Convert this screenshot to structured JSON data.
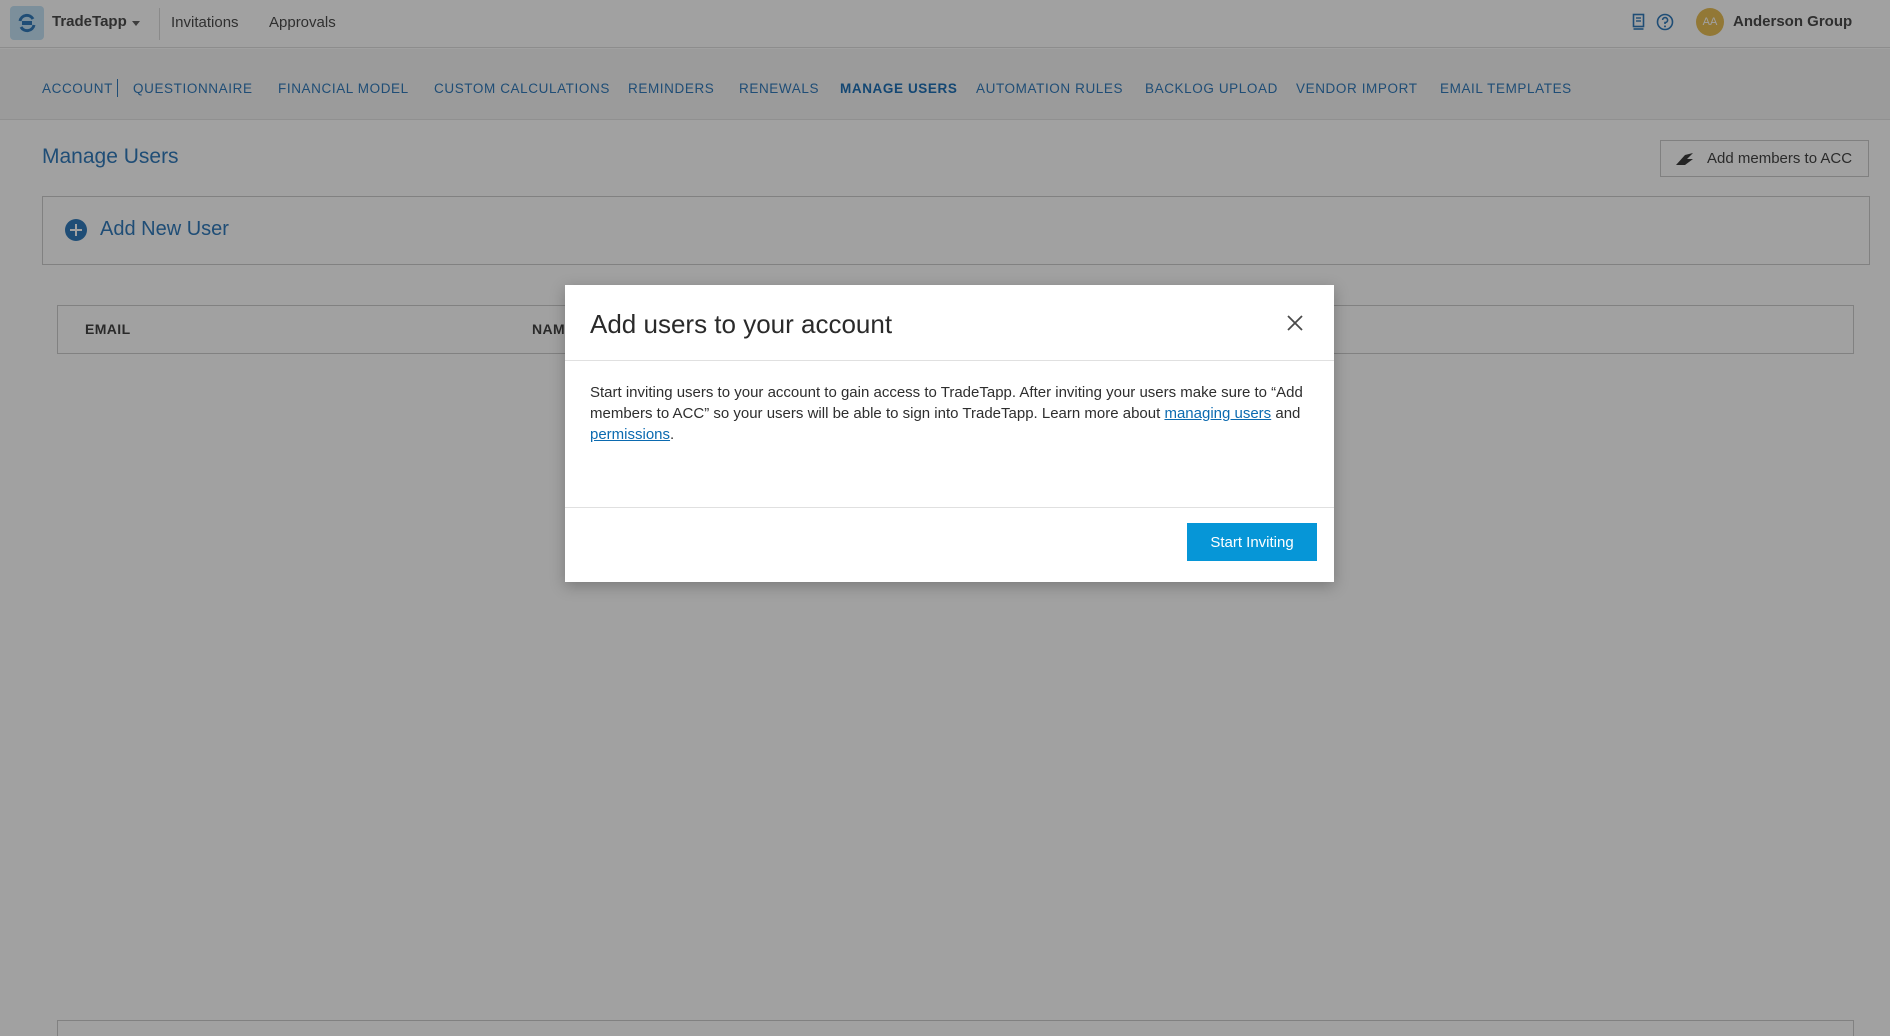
{
  "header": {
    "brand": "TradeTapp",
    "nav": [
      "Invitations",
      "Approvals"
    ],
    "avatar_initials": "AA",
    "org_name": "Anderson Group",
    "icons": [
      "logo-icon",
      "docs-icon",
      "help-icon"
    ]
  },
  "tabs": [
    "ACCOUNT",
    "QUESTIONNAIRE",
    "FINANCIAL MODEL",
    "CUSTOM CALCULATIONS",
    "REMINDERS",
    "RENEWALS",
    "MANAGE USERS",
    "AUTOMATION RULES",
    "BACKLOG UPLOAD",
    "VENDOR IMPORT",
    "EMAIL TEMPLATES"
  ],
  "active_tab": "MANAGE USERS",
  "content": {
    "title": "Manage Users",
    "acc_button": "Add members to ACC",
    "add_new_user": "Add New User",
    "columns": [
      "EMAIL",
      "NAM"
    ]
  },
  "modal": {
    "title": "Add users to your account",
    "body_text": "Start inviting users to your account to gain access to TradeTapp. After inviting your users make sure to “Add members to ACC” so your users will be able to sign into TradeTapp. Learn more about ",
    "link_managing": "managing users",
    "and_text": " and ",
    "link_permissions": "permissions",
    "period": ".",
    "primary_button": "Start Inviting"
  },
  "colors": {
    "accent": "#1f6fb5",
    "primary_button": "#0696d7",
    "avatar": "#e6b848"
  }
}
